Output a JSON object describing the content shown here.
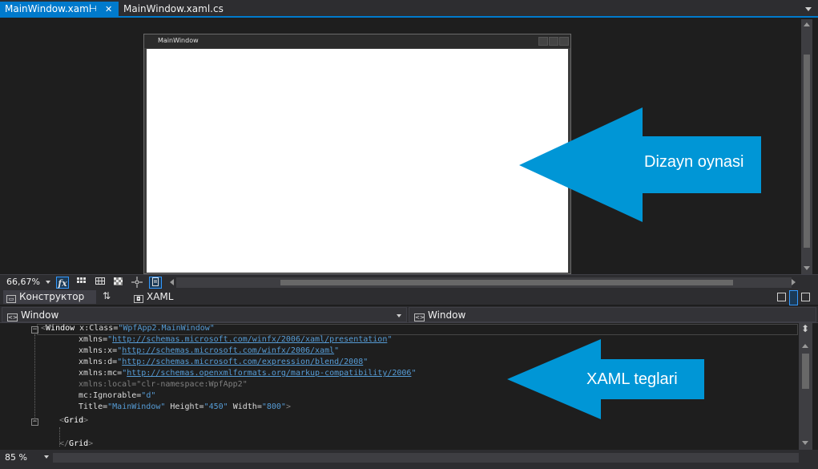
{
  "tabs": [
    {
      "label": "MainWindow.xaml",
      "active": true
    },
    {
      "label": "MainWindow.xaml.cs",
      "active": false
    }
  ],
  "designer": {
    "window_title": "MainWindow",
    "zoom": "66,67%",
    "fx_icon": "fx"
  },
  "split": {
    "designer_tab": "Конструктор",
    "swap_icon": "⇅",
    "xaml_tab": "XAML"
  },
  "selectors": {
    "left": "Window",
    "right": "Window"
  },
  "code": {
    "lines": [
      {
        "open": "<",
        "element": "Window",
        "attr": " x:Class",
        "eq": "=",
        "value": "\"WpfApp2.MainWindow\""
      },
      {
        "attr": "xmlns",
        "eq": "=",
        "q1": "\"",
        "url": "http://schemas.microsoft.com/winfx/2006/xaml/presentation",
        "q2": "\""
      },
      {
        "attr": "xmlns",
        "ns": ":x",
        "eq": "=",
        "q1": "\"",
        "url": "http://schemas.microsoft.com/winfx/2006/xaml",
        "q2": "\""
      },
      {
        "attr": "xmlns",
        "ns": ":d",
        "eq": "=",
        "q1": "\"",
        "url": "http://schemas.microsoft.com/expression/blend/2008",
        "q2": "\""
      },
      {
        "attr": "xmlns",
        "ns": ":mc",
        "eq": "=",
        "q1": "\"",
        "url": "http://schemas.openxmlformats.org/markup-compatibility/2006",
        "q2": "\""
      },
      {
        "text": "xmlns:local=\"clr-namespace:WpfApp2\""
      },
      {
        "attr": "mc",
        "ns": ":Ignorable",
        "eq": "=",
        "value": "\"d\""
      },
      {
        "attr": "Title",
        "eq": "=",
        "value": "\"MainWindow\"",
        "attr2": " Height",
        "eq2": "=",
        "value2": "\"450\"",
        "attr3": " Width",
        "eq3": "=",
        "value3": "\"800\"",
        "close": ">"
      },
      {
        "open": "<",
        "element": "Grid",
        "close": ">"
      },
      {
        "open": "</",
        "element": "Grid",
        "close": ">"
      }
    ]
  },
  "editor_zoom": "85 %",
  "callouts": {
    "design": "Dizayn oynasi",
    "xaml": "XAML teglari"
  },
  "colors": {
    "accent": "#007acc",
    "callout": "#0096d6"
  },
  "icons": {
    "pin": "⊣",
    "close": "✕",
    "splitter": "⬍"
  }
}
